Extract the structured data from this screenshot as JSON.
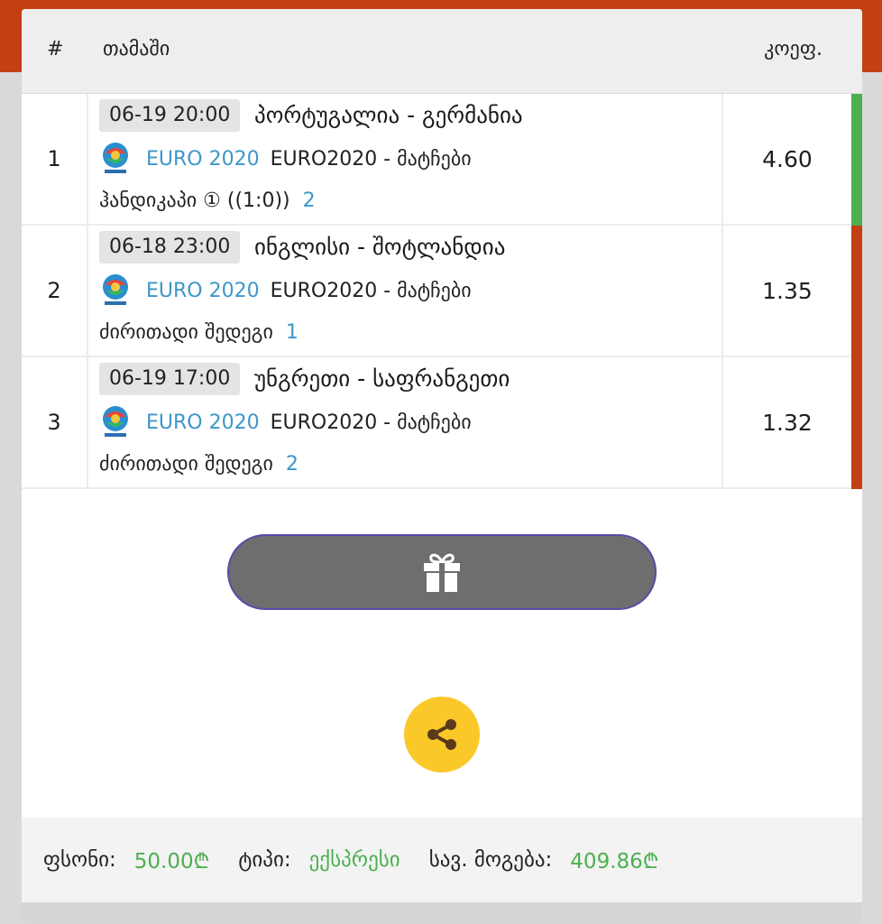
{
  "colors": {
    "header_bg": "#c43f12",
    "win_stripe": "#4caf50",
    "loss_stripe": "#c43f12",
    "link": "#3d97c8",
    "share_button": "#fbc82a",
    "gift_button": "#6e6e6e"
  },
  "table": {
    "headers": {
      "num": "#",
      "game": "თამაში",
      "odds": "კოეფ."
    },
    "rows": [
      {
        "num": "1",
        "datetime": "06-19 20:00",
        "teams": "პორტუგალია - გერმანია",
        "league_logo": "euro-2020-logo-icon",
        "league": "EURO 2020",
        "league_sub": "EURO2020 - მატჩები",
        "market": "ჰანდიკაპი ① ((1:0))",
        "pick": "2",
        "odds": "4.60",
        "status": "won"
      },
      {
        "num": "2",
        "datetime": "06-18 23:00",
        "teams": "ინგლისი - შოტლანდია",
        "league_logo": "euro-2020-logo-icon",
        "league": "EURO 2020",
        "league_sub": "EURO2020 - მატჩები",
        "market": "ძირითადი შედეგი",
        "pick": "1",
        "odds": "1.35",
        "status": "lost"
      },
      {
        "num": "3",
        "datetime": "06-19 17:00",
        "teams": "უნგრეთი - საფრანგეთი",
        "league_logo": "euro-2020-logo-icon",
        "league": "EURO 2020",
        "league_sub": "EURO2020 - მატჩები",
        "market": "ძირითადი შედეგი",
        "pick": "2",
        "odds": "1.32",
        "status": "lost"
      }
    ]
  },
  "actions": {
    "gift_icon": "gift-icon",
    "share_icon": "share-icon"
  },
  "footer": {
    "stake_label": "ფსონი:",
    "stake_value": "50.00₾",
    "type_label": "ტიპი:",
    "type_value": "ექსპრესი",
    "win_label": "სავ. მოგება:",
    "win_value": "409.86₾"
  }
}
